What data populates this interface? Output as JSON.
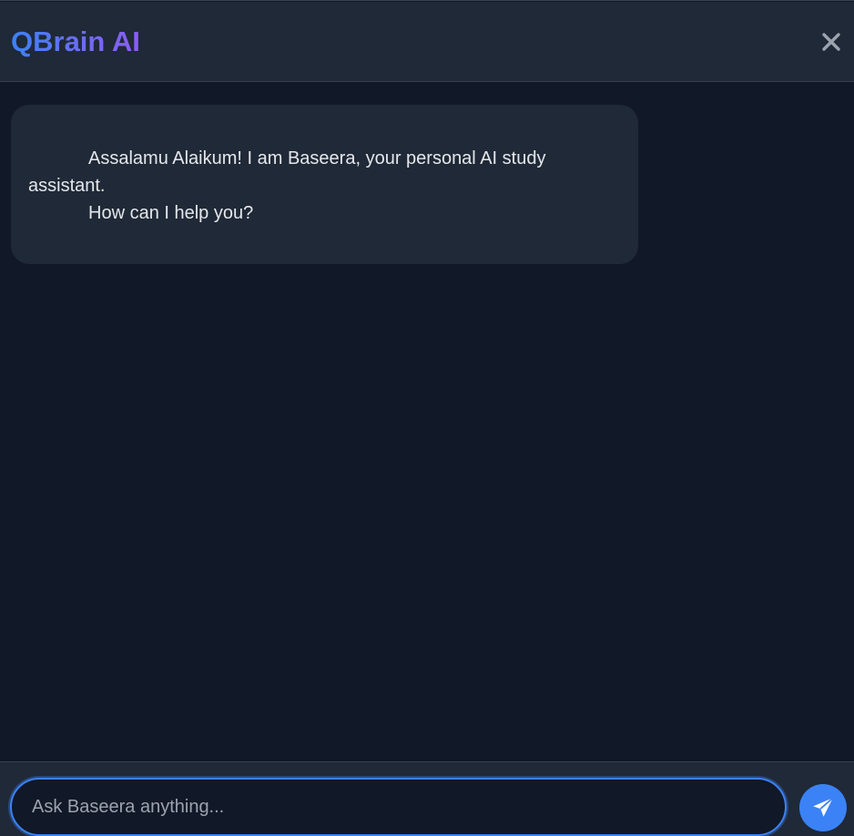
{
  "header": {
    "title": "QBrain AI",
    "close_icon": "close-icon"
  },
  "chat": {
    "messages": [
      {
        "sender": "assistant",
        "line1": "Assalamu Alaikum! I am Baseera, your personal AI study assistant.",
        "line2": "How can I help you?"
      }
    ]
  },
  "composer": {
    "placeholder": "Ask Baseera anything...",
    "value": "",
    "send_icon": "paper-plane-icon"
  },
  "colors": {
    "background": "#111827",
    "panel": "#1f2937",
    "accent_blue": "#3b82f6",
    "accent_purple": "#8b5cf6"
  }
}
